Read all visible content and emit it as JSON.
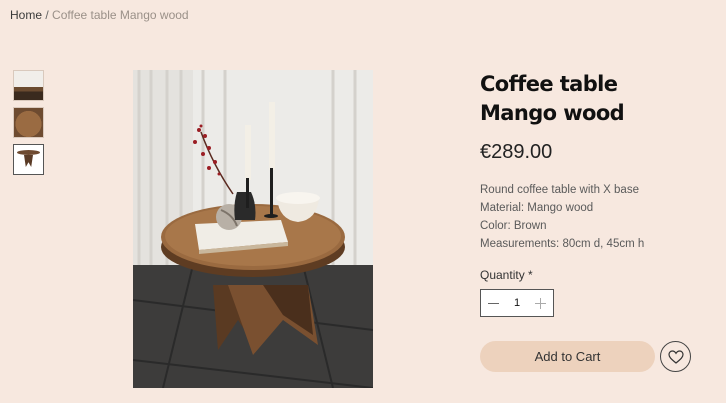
{
  "breadcrumb": {
    "home": "Home",
    "separator": "/",
    "current": "Coffee table Mango wood"
  },
  "gallery": {
    "thumbnails": [
      {
        "name": "table-with-candles"
      },
      {
        "name": "table-top-view"
      },
      {
        "name": "table-product-cutout"
      }
    ]
  },
  "product": {
    "title": "Coffee table Mango wood",
    "price": "€289.00",
    "description": [
      "Round coffee table with X base",
      "Material: Mango wood",
      "Color: Brown",
      "Measurements: 80cm d, 45cm h"
    ],
    "quantity_label": "Quantity *",
    "quantity_value": "1",
    "add_to_cart_label": "Add to Cart"
  },
  "colors": {
    "background": "#f7e8df",
    "cart_button": "#edd2bd",
    "text_dark": "#111111"
  },
  "icons": {
    "decrease": "minus-icon",
    "increase": "plus-icon",
    "wishlist": "heart-icon"
  }
}
